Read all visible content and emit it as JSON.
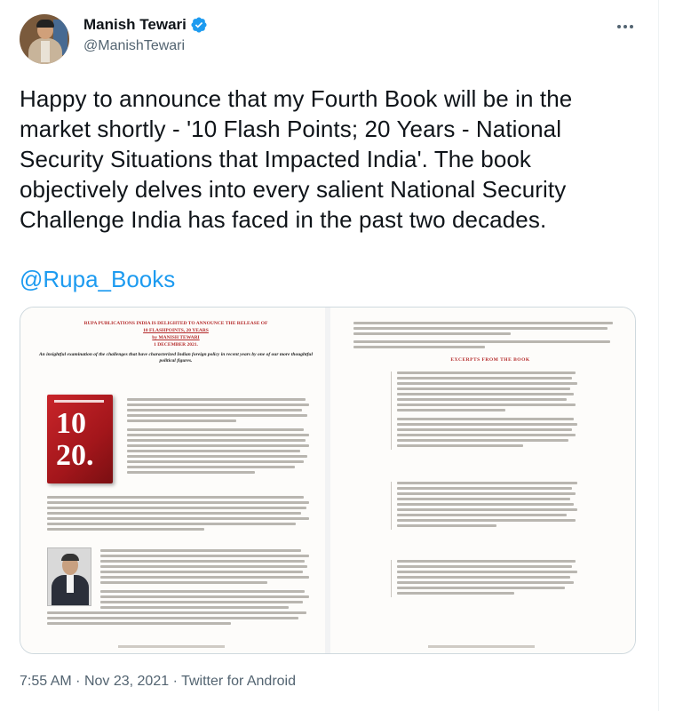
{
  "author": {
    "name": "Manish Tewari",
    "handle": "@ManishTewari",
    "verified": true
  },
  "tweet": {
    "text": "Happy to announce that my Fourth Book will be in the market shortly - '10 Flash Points; 20 Years  - National Security Situations that Impacted India'. The book objectively delves into every salient National Security Challenge India has faced in the past two decades.",
    "mention": "@Rupa_Books"
  },
  "media": {
    "left_page": {
      "heading": "RUPA PUBLICATIONS INDIA IS DELIGHTED TO ANNOUNCE THE RELEASE OF",
      "book_title": "10 FLASHPOINTS, 20 YEARS",
      "by_line": "by MANISH TEWARI",
      "release_date": "1 DECEMBER 2021.",
      "subtitle": "An insightful examination of the challenges that have characterized Indian foreign policy in recent years by one of our more thoughtful political figures.",
      "cover_numbers": [
        "10",
        "20."
      ]
    },
    "right_page": {
      "excerpts_heading": "EXCERPTS FROM THE BOOK"
    }
  },
  "meta": {
    "time": "7:55 AM",
    "separator": "·",
    "date": "Nov 23, 2021",
    "source": "Twitter for Android"
  },
  "colors": {
    "link": "#1d9bf0",
    "verified": "#1d9bf0",
    "muted": "#536471",
    "accent_red": "#b42a2a"
  }
}
